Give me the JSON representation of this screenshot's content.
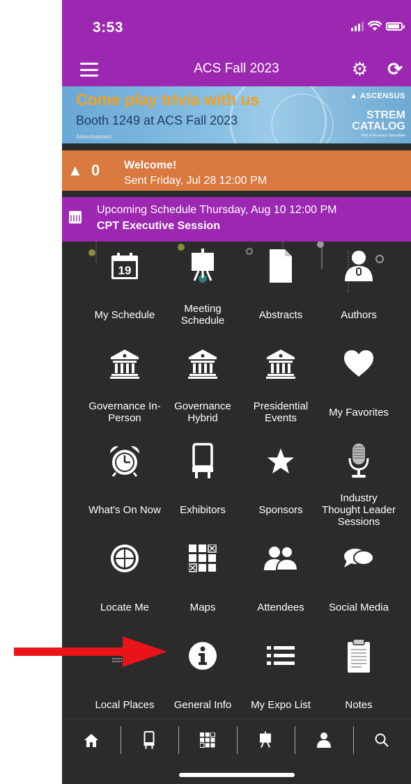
{
  "status": {
    "time": "3:53"
  },
  "header": {
    "title": "ACS Fall 2023"
  },
  "ad": {
    "headline": "Come play trivia with us",
    "subline": "Booth 1249 at ACS Fall 2023",
    "label": "Advertisement",
    "brand": "ASCENSUS",
    "product_line1": "STREM",
    "product_line2": "CATALOG",
    "tagline": "Part of Ascensus Specialties"
  },
  "alert": {
    "count": "0",
    "title": "Welcome!",
    "subtitle": "Sent Friday, Jul 28 12:00 PM"
  },
  "schedule": {
    "line1": "Upcoming Schedule Thursday, Aug 10 12:00 PM",
    "line2": "CPT Executive Session"
  },
  "tiles": [
    {
      "label": "My Schedule",
      "icon": "calendar-icon",
      "calendar_day": "19"
    },
    {
      "label": "Meeting Schedule",
      "icon": "presentation-board-icon"
    },
    {
      "label": "Abstracts",
      "icon": "document-icon"
    },
    {
      "label": "Authors",
      "icon": "speaker-icon"
    },
    {
      "label": "Governance In-Person",
      "icon": "building-icon"
    },
    {
      "label": "Governance Hybrid",
      "icon": "building-icon"
    },
    {
      "label": "Presidential Events",
      "icon": "building-icon"
    },
    {
      "label": "My Favorites",
      "icon": "heart-icon"
    },
    {
      "label": "What's On Now",
      "icon": "alarm-clock-icon"
    },
    {
      "label": "Exhibitors",
      "icon": "booth-icon"
    },
    {
      "label": "Sponsors",
      "icon": "star-icon"
    },
    {
      "label": "Industry Thought Leader Sessions",
      "icon": "microphone-icon"
    },
    {
      "label": "Locate Me",
      "icon": "target-icon"
    },
    {
      "label": "Maps",
      "icon": "floor-map-icon"
    },
    {
      "label": "Attendees",
      "icon": "people-icon"
    },
    {
      "label": "Social Media",
      "icon": "chat-bubble-icon"
    },
    {
      "label": "Local Places",
      "icon": "local-places-icon"
    },
    {
      "label": "General Info",
      "icon": "info-icon"
    },
    {
      "label": "My Expo List",
      "icon": "list-icon"
    },
    {
      "label": "Notes",
      "icon": "clipboard-icon"
    }
  ],
  "bottom_nav": [
    "home-icon",
    "booth-icon",
    "floor-map-icon",
    "presentation-board-icon",
    "speaker-icon",
    "search-icon"
  ],
  "colors": {
    "primary": "#9c27b0",
    "alert": "#d9783f",
    "background": "#2b2b2b",
    "annotation_arrow": "#e8141a"
  }
}
